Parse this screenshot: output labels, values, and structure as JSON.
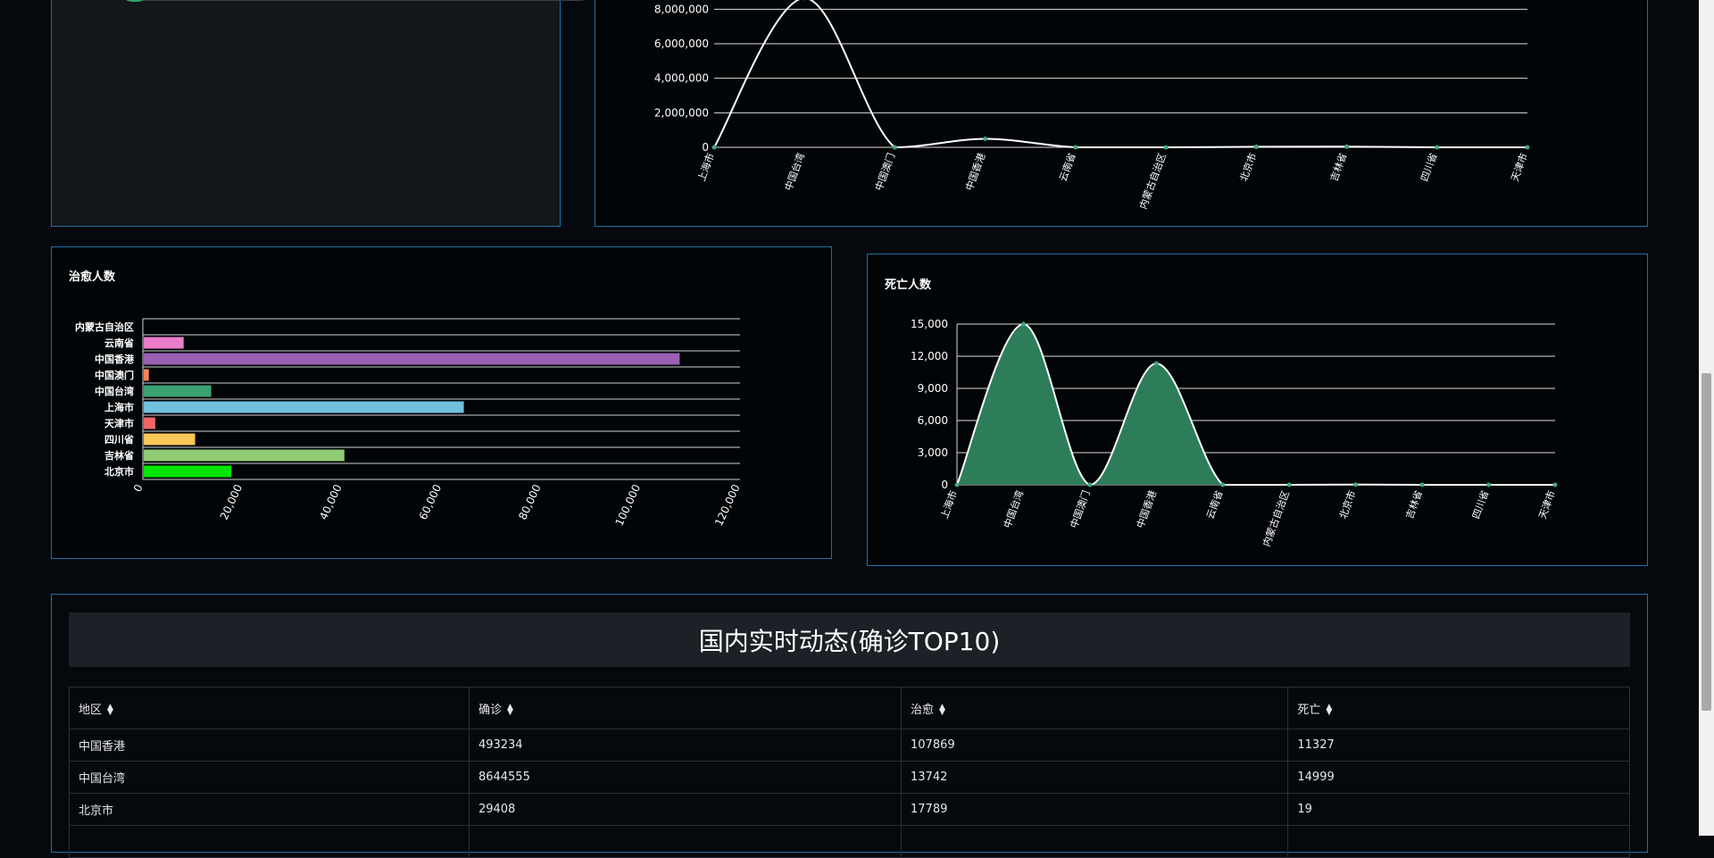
{
  "table": {
    "title": "国内实时动态(确诊TOP10)",
    "columns": [
      "地区",
      "确诊",
      "治愈",
      "死亡"
    ],
    "rows": [
      [
        "中国香港",
        "493234",
        "107869",
        "11327"
      ],
      [
        "中国台湾",
        "8644555",
        "13742",
        "14999"
      ],
      [
        "北京市",
        "29408",
        "17789",
        "19"
      ]
    ]
  },
  "chart_data": [
    {
      "type": "line",
      "title": "",
      "categories": [
        "上海市",
        "中国台湾",
        "中国澳门",
        "中国香港",
        "云南省",
        "内蒙古自治区",
        "北京市",
        "吉林省",
        "四川省",
        "天津市"
      ],
      "series": [
        {
          "values": [
            0,
            8644555,
            800,
            493234,
            2100,
            1700,
            29408,
            40000,
            1400,
            2100
          ]
        }
      ],
      "ylim": [
        0,
        9000000
      ],
      "y_ticks_visible": [
        0,
        2000000,
        4000000,
        6000000,
        8000000
      ],
      "grid": true,
      "line_color": "#ffffff",
      "point_color": "#3fa783"
    },
    {
      "type": "bar",
      "orientation": "horizontal",
      "title": "治愈人数",
      "categories": [
        "北京市",
        "吉林省",
        "四川省",
        "天津市",
        "上海市",
        "中国台湾",
        "中国澳门",
        "中国香港",
        "云南省",
        "内蒙古自治区"
      ],
      "values": [
        17789,
        40500,
        10500,
        2500,
        64500,
        13742,
        1200,
        107869,
        8200,
        0
      ],
      "colors": [
        "#00e600",
        "#91cc75",
        "#fac858",
        "#ee6666",
        "#73c0de",
        "#3ba272",
        "#fc8452",
        "#9a60b4",
        "#ea7ccc",
        "#5470c6"
      ],
      "xlim": [
        0,
        120000
      ],
      "x_ticks": [
        0,
        20000,
        40000,
        60000,
        80000,
        100000,
        120000
      ],
      "grid": true
    },
    {
      "type": "area",
      "title": "死亡人数",
      "categories": [
        "上海市",
        "中国台湾",
        "中国澳门",
        "中国香港",
        "云南省",
        "内蒙古自治区",
        "北京市",
        "吉林省",
        "四川省",
        "天津市"
      ],
      "series": [
        {
          "values": [
            0,
            14999,
            0,
            11327,
            0,
            0,
            19,
            0,
            0,
            0
          ]
        }
      ],
      "ylim": [
        0,
        15000
      ],
      "y_ticks": [
        0,
        3000,
        6000,
        9000,
        12000,
        15000
      ],
      "grid": true,
      "fill_color": "#2e7d5a",
      "line_color": "#ffffff"
    }
  ]
}
